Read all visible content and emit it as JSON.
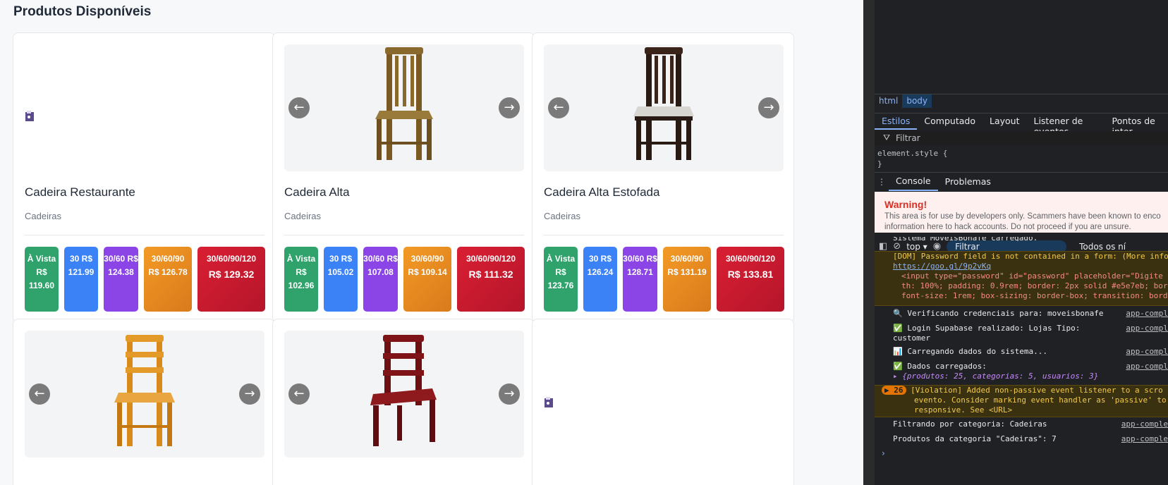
{
  "page": {
    "title": "Produtos Disponíveis"
  },
  "price_labels": {
    "vista": "À Vista R$",
    "p30": "30 R$",
    "p3060": "30/60 R$",
    "p306090": "30/60/90",
    "p306090120": "30/60/90/120"
  },
  "products": [
    {
      "name": "Cadeira Restaurante",
      "category": "Cadeiras",
      "image": "broken-image",
      "prices": {
        "vista": "119.60",
        "p30": "121.99",
        "p3060": "124.38",
        "p306090": "R$ 126.78",
        "p306090120": "R$ 129.32"
      }
    },
    {
      "name": "Cadeira Alta",
      "category": "Cadeiras",
      "image": "chair-brown",
      "prices": {
        "vista": "102.96",
        "p30": "105.02",
        "p3060": "107.08",
        "p306090": "R$ 109.14",
        "p306090120": "R$ 111.32"
      }
    },
    {
      "name": "Cadeira Alta Estofada",
      "category": "Cadeiras",
      "image": "chair-dark",
      "prices": {
        "vista": "123.76",
        "p30": "126.24",
        "p3060": "128.71",
        "p306090": "R$ 131.19",
        "p306090120": "R$ 133.81"
      }
    },
    {
      "image": "chair-yellow"
    },
    {
      "image": "chair-red"
    },
    {
      "image": "broken-image"
    }
  ],
  "carousel": {
    "prev": "←",
    "next": "→"
  },
  "devtools": {
    "breadcrumbs": [
      "html",
      "body"
    ],
    "style_tabs": [
      "Estilos",
      "Computado",
      "Layout",
      "Listener de eventos",
      "Pontos de inter"
    ],
    "filter_placeholder": "Filtrar",
    "element_style": "element.style {",
    "element_style_close": "}",
    "console_tabs": [
      "Console",
      "Problemas"
    ],
    "warning": {
      "title": "Warning!",
      "line1": "This area is for use by developers only. Scammers have been known to enco",
      "line2": "information here to hack accounts. Do not proceed if you are unsure."
    },
    "toolbar": {
      "context": "top ▾",
      "filter": "Filtrar",
      "levels": "Todos os ní"
    },
    "logs": {
      "cutoff": "Sistema MoveisBonafe carregado.",
      "dom_warn": "[DOM] Password field is not contained in a form: (More info",
      "dom_link": "https://goo.gl/9p2vKq",
      "dom_code1": "<input type=\"password\" id=\"password\" placeholder=\"Digite",
      "dom_code2": "th: 100%; padding: 0.9rem; border: 2px solid #e5e7eb; bor",
      "dom_code3": "font-size: 1rem; box-sizing: border-box; transition: bord",
      "verify": "🔍 Verificando credenciais para: moveisbonafe",
      "login1": "✅ Login Supabase realizado: Lojas Tipo:",
      "login2": "customer",
      "loading": "📊 Carregando dados do sistema...",
      "loaded": "✅ Dados carregados:",
      "loaded_obj": "▸ {produtos: 25, categorias: 5, usuarios: 3}",
      "violation_count": "26",
      "violation1": "[Violation] Added non-passive event listener to a scro",
      "violation2": "evento. Consider marking event handler as 'passive' to",
      "violation3": "responsive. See <URL>",
      "filter_cat": "Filtrando por categoria: Cadeiras",
      "products_cat": "Produtos da categoria \"Cadeiras\": 7",
      "source": "app-compl",
      "source2": "app-comple"
    },
    "prompt": "›"
  }
}
